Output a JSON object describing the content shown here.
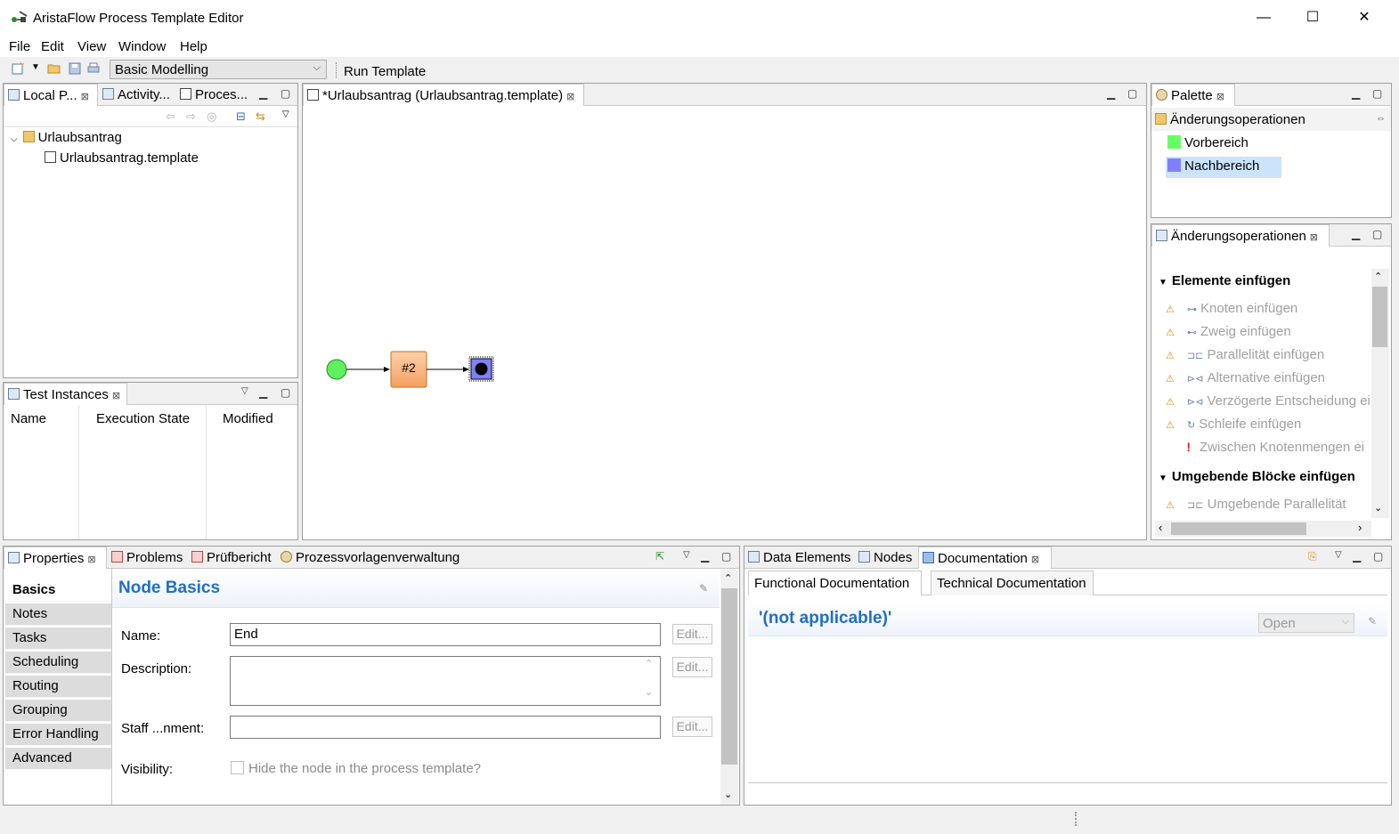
{
  "window": {
    "title": "AristaFlow Process Template Editor",
    "minimize": "—",
    "maximize": "☐",
    "close": "✕"
  },
  "menu": [
    "File",
    "Edit",
    "View",
    "Window",
    "Help"
  ],
  "toolbar": {
    "perspective": "Basic Modelling",
    "run_template": "Run Template"
  },
  "left_panel": {
    "tabs": [
      "Local P...",
      "Activity...",
      "Proces..."
    ],
    "tree": {
      "folder": "Urlaubsantrag",
      "file": "Urlaubsantrag.template"
    }
  },
  "test_instances": {
    "tab": "Test Instances",
    "columns": [
      "Name",
      "Execution State",
      "Modified"
    ]
  },
  "editor": {
    "tab": "*Urlaubsantrag (Urlaubsantrag.template)",
    "node_label": "#2"
  },
  "palette": {
    "tab": "Palette",
    "group": "Änderungsoperationen",
    "items": [
      {
        "label": "Vorbereich",
        "color": "#66ff66"
      },
      {
        "label": "Nachbereich",
        "color": "#8080ff"
      }
    ]
  },
  "operations": {
    "tab": "Änderungsoperationen",
    "section1": "Elemente einfügen",
    "items1": [
      "Knoten einfügen",
      "Zweig einfügen",
      "Parallelität einfügen",
      "Alternative einfügen",
      "Verzögerte Entscheidung ei",
      "Schleife einfügen",
      "Zwischen Knotenmengen ei"
    ],
    "section2": "Umgebende Blöcke einfügen",
    "items2": [
      "Umgebende Parallelität"
    ]
  },
  "properties": {
    "tabs": [
      "Properties",
      "Problems",
      "Prüfbericht",
      "Prozessvorlagenverwaltung"
    ],
    "nav": [
      "Basics",
      "Notes",
      "Tasks",
      "Scheduling",
      "Routing",
      "Grouping",
      "Error Handling",
      "Advanced"
    ],
    "heading": "Node Basics",
    "name_label": "Name:",
    "name_value": "End",
    "description_label": "Description:",
    "description_value": "",
    "staff_label": "Staff ...nment:",
    "staff_value": "",
    "visibility_label": "Visibility:",
    "visibility_check": "Hide the node in the process template?",
    "edit": "Edit..."
  },
  "documentation": {
    "tabs": [
      "Data Elements",
      "Nodes",
      "Documentation"
    ],
    "subtabs": [
      "Functional Documentation",
      "Technical Documentation"
    ],
    "heading": "'(not applicable)'",
    "status": "Open"
  }
}
